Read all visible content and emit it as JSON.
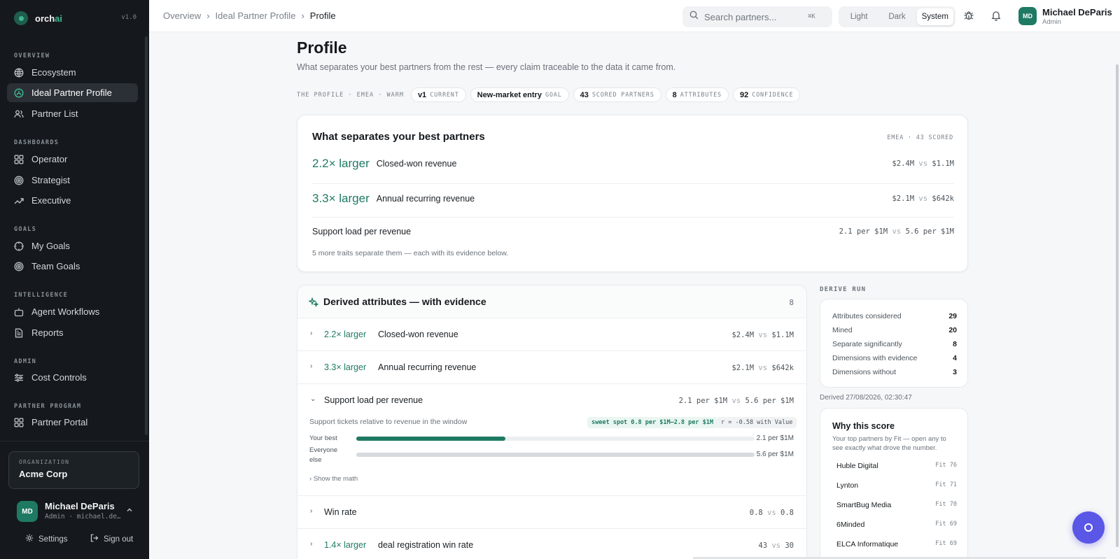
{
  "app": {
    "brand_main": "orch",
    "brand_accent": "ai",
    "version": "v1.0"
  },
  "sidebar": {
    "sections": [
      {
        "label": "OVERVIEW",
        "items": [
          {
            "label": "Ecosystem",
            "icon": "globe-icon"
          },
          {
            "label": "Ideal Partner Profile",
            "icon": "profile-icon",
            "active": true
          },
          {
            "label": "Partner List",
            "icon": "users-icon"
          }
        ]
      },
      {
        "label": "DASHBOARDS",
        "items": [
          {
            "label": "Operator",
            "icon": "grid-icon"
          },
          {
            "label": "Strategist",
            "icon": "target-icon"
          },
          {
            "label": "Executive",
            "icon": "trend-icon"
          }
        ]
      },
      {
        "label": "GOALS",
        "items": [
          {
            "label": "My Goals",
            "icon": "crosshair-icon"
          },
          {
            "label": "Team Goals",
            "icon": "target-icon"
          }
        ]
      },
      {
        "label": "INTELLIGENCE",
        "items": [
          {
            "label": "Agent Workflows",
            "icon": "bot-icon"
          },
          {
            "label": "Reports",
            "icon": "report-icon"
          }
        ]
      },
      {
        "label": "ADMIN",
        "items": [
          {
            "label": "Cost Controls",
            "icon": "sliders-icon"
          }
        ]
      },
      {
        "label": "PARTNER PROGRAM",
        "items": [
          {
            "label": "Partner Portal",
            "icon": "grid-icon"
          }
        ]
      }
    ],
    "org": {
      "label": "ORGANIZATION",
      "name": "Acme Corp"
    },
    "user": {
      "initials": "MD",
      "name": "Michael DeParis",
      "meta": "Admin · michael.de…"
    },
    "settings_label": "Settings",
    "signout_label": "Sign out"
  },
  "topbar": {
    "breadcrumb": [
      "Overview",
      "Ideal Partner Profile",
      "Profile"
    ],
    "search_placeholder": "Search partners...",
    "search_kbd": "⌘K",
    "theme_options": [
      "Light",
      "Dark",
      "System"
    ],
    "theme_selected": "System",
    "user": {
      "initials": "MD",
      "name": "Michael DeParis",
      "role": "Admin"
    }
  },
  "page": {
    "title": "Profile",
    "subtitle": "What separates your best partners from the rest — every claim traceable to the data it came from.",
    "meta_label": "THE PROFILE · EMEA · WARM",
    "chips": [
      {
        "value": "v1",
        "label": "CURRENT"
      },
      {
        "value": "New-market entry",
        "label": "GOAL"
      },
      {
        "value": "43",
        "label": "SCORED PARTNERS"
      },
      {
        "value": "8",
        "label": "ATTRIBUTES"
      },
      {
        "value": "92",
        "label": "CONFIDENCE"
      }
    ]
  },
  "summary": {
    "title": "What separates your best partners",
    "tag": "EMEA · 43 SCORED",
    "rows": [
      {
        "big": "2.2× larger",
        "label": "Closed-won revenue",
        "best": "$2.4M",
        "rest": "$1.1M"
      },
      {
        "big": "3.3× larger",
        "label": "Annual recurring revenue",
        "best": "$2.1M",
        "rest": "$642k"
      },
      {
        "big": "",
        "label": "Support load per revenue",
        "best": "2.1 per $1M",
        "rest": "5.6 per $1M"
      }
    ],
    "vs": "vs",
    "note": "5 more traits separate them — each with its evidence below."
  },
  "attributes": {
    "title": "Derived attributes — with evidence",
    "count": "8",
    "rows": [
      {
        "big": "2.2× larger",
        "label": "Closed-won revenue",
        "best": "$2.4M",
        "rest": "$1.1M",
        "expanded": false
      },
      {
        "big": "3.3× larger",
        "label": "Annual recurring revenue",
        "best": "$2.1M",
        "rest": "$642k",
        "expanded": false
      },
      {
        "big": "",
        "label": "Support load per revenue",
        "best": "2.1 per $1M",
        "rest": "5.6 per $1M",
        "expanded": true
      },
      {
        "big": "",
        "label": "Win rate",
        "best": "0.8",
        "rest": "0.8",
        "expanded": false
      },
      {
        "big": "1.4× larger",
        "label": "deal registration win rate",
        "best": "43",
        "rest": "30",
        "expanded": false
      }
    ],
    "expanded_detail": {
      "description": "Support tickets relative to revenue in the window",
      "sweet_spot": "sweet spot 0.8 per $1M–2.8 per $1M",
      "correlation": "r = -0.58 with Value",
      "best_label": "Your best",
      "rest_label": "Everyone else",
      "best_value": "2.1 per $1M",
      "rest_value": "5.6 per $1M",
      "best_fraction": 0.375,
      "rest_fraction": 1.0,
      "show_math": "Show the math"
    }
  },
  "derive_run": {
    "label": "DERIVE RUN",
    "rows": [
      {
        "label": "Attributes considered",
        "value": "29"
      },
      {
        "label": "Mined",
        "value": "20"
      },
      {
        "label": "Separate significantly",
        "value": "8"
      },
      {
        "label": "Dimensions with evidence",
        "value": "4"
      },
      {
        "label": "Dimensions without",
        "value": "3"
      }
    ],
    "derived_at": "Derived 27/08/2026, 02:30:47"
  },
  "why": {
    "title": "Why this score",
    "description": "Your top partners by Fit — open any to see exactly what drove the number.",
    "partners": [
      {
        "name": "Huble Digital",
        "fit": "Fit 76"
      },
      {
        "name": "Lynton",
        "fit": "Fit 71"
      },
      {
        "name": "SmartBug Media",
        "fit": "Fit 70"
      },
      {
        "name": "6Minded",
        "fit": "Fit 69"
      },
      {
        "name": "ELCA Informatique",
        "fit": "Fit 69"
      }
    ]
  },
  "colors": {
    "accent": "#1f7a63",
    "sidebar": "#15191d",
    "fab": "#5a56e6"
  }
}
